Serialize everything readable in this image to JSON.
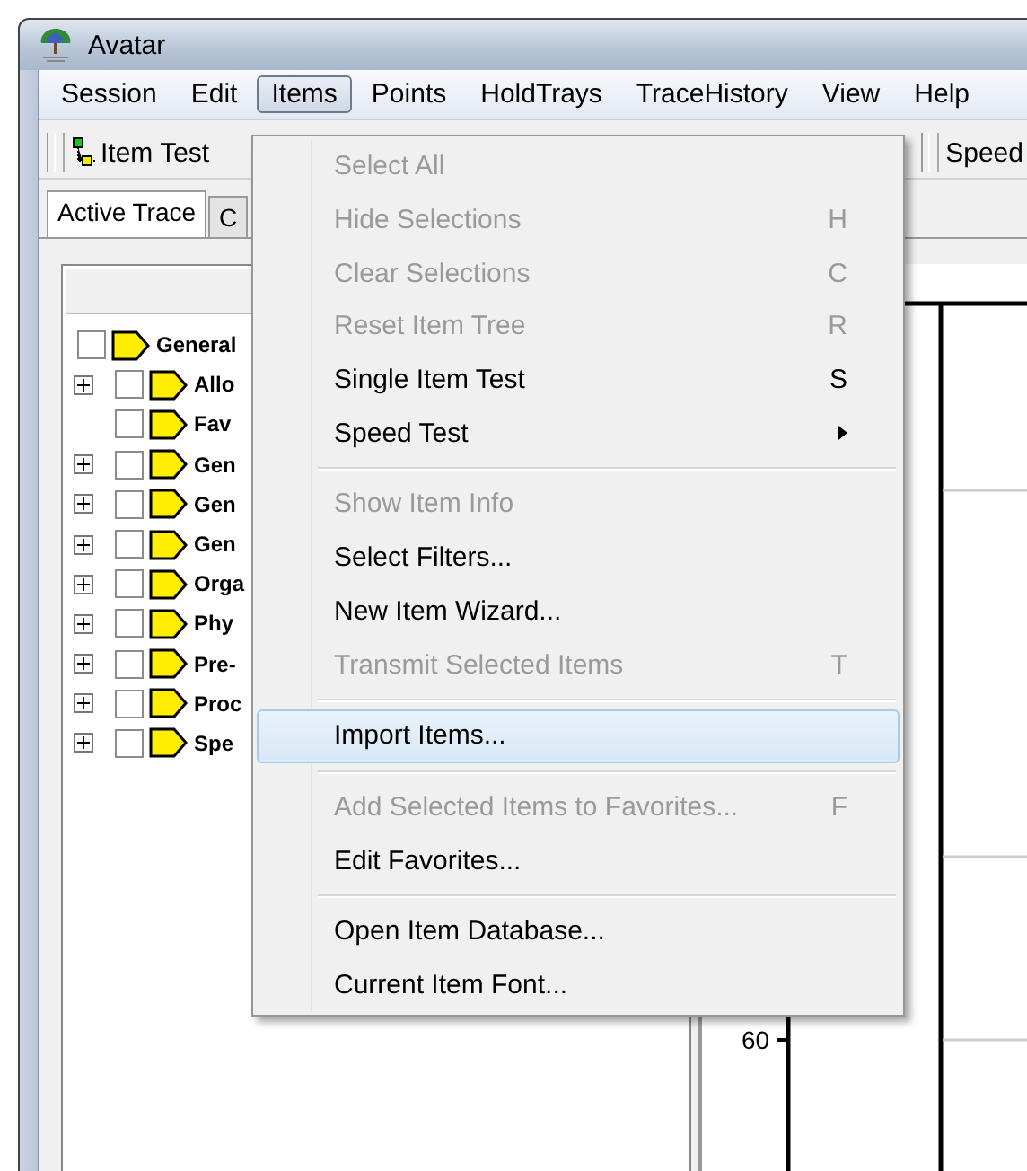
{
  "window": {
    "title": "Avatar"
  },
  "menubar": [
    {
      "label": "Session",
      "selected": false
    },
    {
      "label": "Edit",
      "selected": false
    },
    {
      "label": "Items",
      "selected": true
    },
    {
      "label": "Points",
      "selected": false
    },
    {
      "label": "HoldTrays",
      "selected": false
    },
    {
      "label": "TraceHistory",
      "selected": false
    },
    {
      "label": "View",
      "selected": false
    },
    {
      "label": "Help",
      "selected": false
    }
  ],
  "toolbar": [
    {
      "label": "Item Test",
      "kind": "icon-button"
    },
    {
      "label": "Speed",
      "kind": "text-button"
    }
  ],
  "tabs": [
    {
      "label": "Active Trace",
      "selected": true
    },
    {
      "label": "C",
      "selected": false
    }
  ],
  "tree": [
    {
      "label": "General",
      "expandable": false,
      "checked": false,
      "children": [
        {
          "label": "Allo",
          "expandable": true,
          "checked": false
        },
        {
          "label": "Fav",
          "expandable": false,
          "checked": false
        },
        {
          "label": "Gen",
          "expandable": true,
          "checked": false
        },
        {
          "label": "Gen",
          "expandable": true,
          "checked": false
        },
        {
          "label": "Gen",
          "expandable": true,
          "checked": false
        },
        {
          "label": "Orga",
          "expandable": true,
          "checked": false
        },
        {
          "label": "Phy",
          "expandable": true,
          "checked": false
        },
        {
          "label": "Pre-",
          "expandable": true,
          "checked": false
        },
        {
          "label": "Proc",
          "expandable": true,
          "checked": false
        },
        {
          "label": "Spe",
          "expandable": true,
          "checked": false
        }
      ]
    }
  ],
  "chart": {
    "axis_label": "60"
  },
  "menu": [
    {
      "kind": "item",
      "label": "Select All",
      "disabled": true,
      "selected": false
    },
    {
      "kind": "item",
      "label": "Hide Selections",
      "shortcut": "H",
      "disabled": true,
      "selected": false
    },
    {
      "kind": "item",
      "label": "Clear Selections",
      "shortcut": "C",
      "disabled": true,
      "selected": false
    },
    {
      "kind": "item",
      "label": "Reset Item Tree",
      "shortcut": "R",
      "disabled": true,
      "selected": false
    },
    {
      "kind": "item",
      "label": "Single Item Test",
      "shortcut": "S",
      "disabled": false,
      "selected": false
    },
    {
      "kind": "item",
      "label": "Speed Test",
      "submenu": true,
      "disabled": false,
      "selected": false
    },
    {
      "kind": "separator"
    },
    {
      "kind": "item",
      "label": "Show Item Info",
      "disabled": true,
      "selected": false
    },
    {
      "kind": "item",
      "label": "Select Filters...",
      "disabled": false,
      "selected": false
    },
    {
      "kind": "item",
      "label": "New Item Wizard...",
      "disabled": false,
      "selected": false
    },
    {
      "kind": "item",
      "label": "Transmit Selected Items",
      "shortcut": "T",
      "disabled": true,
      "selected": false
    },
    {
      "kind": "separator"
    },
    {
      "kind": "item",
      "label": "Import Items...",
      "disabled": false,
      "selected": true
    },
    {
      "kind": "separator"
    },
    {
      "kind": "item",
      "label": "Add Selected Items to Favorites...",
      "shortcut": "F",
      "disabled": true,
      "selected": false
    },
    {
      "kind": "item",
      "label": "Edit Favorites...",
      "disabled": false,
      "selected": false
    },
    {
      "kind": "separator"
    },
    {
      "kind": "item",
      "label": "Open Item Database...",
      "disabled": false,
      "selected": false
    },
    {
      "kind": "item",
      "label": "Current Item Font...",
      "disabled": false,
      "selected": false
    }
  ]
}
